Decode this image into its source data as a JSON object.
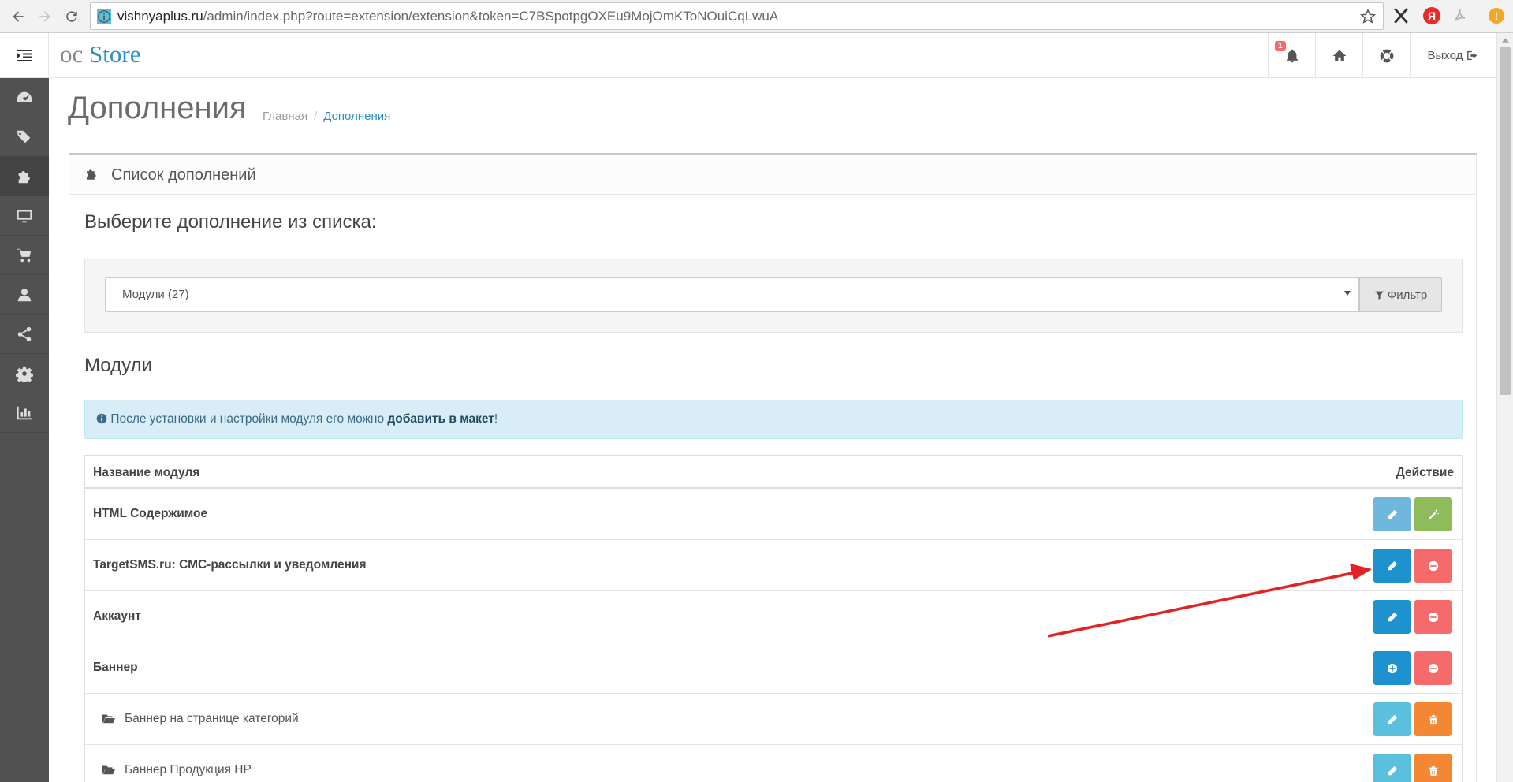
{
  "browser": {
    "url_host": "vishnyaplus.ru",
    "url_path": "/admin/index.php?route=extension/extension&token=C7BSpotpgOXEu9MojOmKToNOuiCqLwuA",
    "ext_yandex_letter": "Я"
  },
  "header": {
    "logo_oc": "oc",
    "logo_store": "Store",
    "notification_count": "1",
    "logout_label": "Выход"
  },
  "page": {
    "title": "Дополнения",
    "breadcrumb": {
      "home": "Главная",
      "separator": "/",
      "current": "Дополнения"
    }
  },
  "panel": {
    "title": "Список дополнений",
    "choose_label": "Выберите дополнение из списка:",
    "select_value": "Модули (27)",
    "filter_label": "Фильтр",
    "section_title": "Модули",
    "alert": {
      "text": "После установки и настройки модуля его можно ",
      "link": "добавить в макет",
      "end": "!"
    }
  },
  "table": {
    "columns": [
      "Название модуля",
      "Действие"
    ],
    "rows": [
      {
        "name": "HTML Содержимое",
        "actions": [
          "edit-light",
          "wand"
        ]
      },
      {
        "name": "TargetSMS.ru: СМС-рассылки и уведомления",
        "actions": [
          "edit",
          "uninstall"
        ]
      },
      {
        "name": "Аккаунт",
        "actions": [
          "edit",
          "uninstall"
        ]
      },
      {
        "name": "Баннер",
        "actions": [
          "add",
          "uninstall"
        ]
      },
      {
        "name": "Баннер на странице категорий",
        "actions": [
          "edit",
          "delete"
        ]
      },
      {
        "name": "Баннер Продукция HP",
        "actions": [
          "edit",
          "delete"
        ]
      }
    ]
  },
  "colors": {
    "primary": "#1e91cf",
    "danger": "#f56b6b",
    "success": "#8fbc5a",
    "info": "#5bc0de",
    "warning": "#f38733",
    "sidebar": "#515151",
    "arrow": "#e52222"
  }
}
